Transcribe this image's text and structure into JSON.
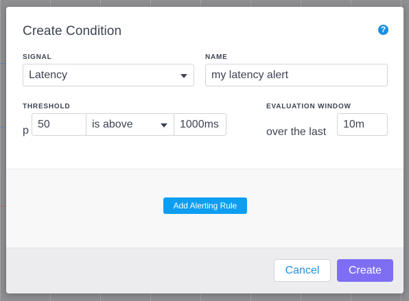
{
  "dialog": {
    "title": "Create Condition",
    "help_icon": "?"
  },
  "signal": {
    "label": "SIGNAL",
    "selected": "Latency"
  },
  "name": {
    "label": "NAME",
    "value": "my latency alert"
  },
  "threshold": {
    "label": "THRESHOLD",
    "prefix": "p",
    "percentile": "50",
    "comparator": "is above",
    "value": "1000ms"
  },
  "evaluation_window": {
    "label": "EVALUATION WINDOW",
    "prefix": "over the last",
    "value": "10m"
  },
  "alerting": {
    "add_rule_label": "Add Alerting Rule"
  },
  "footer": {
    "cancel_label": "Cancel",
    "create_label": "Create"
  },
  "colors": {
    "primary": "#7e6ef4",
    "accent": "#0d9ef2",
    "link": "#1b8fe0"
  }
}
